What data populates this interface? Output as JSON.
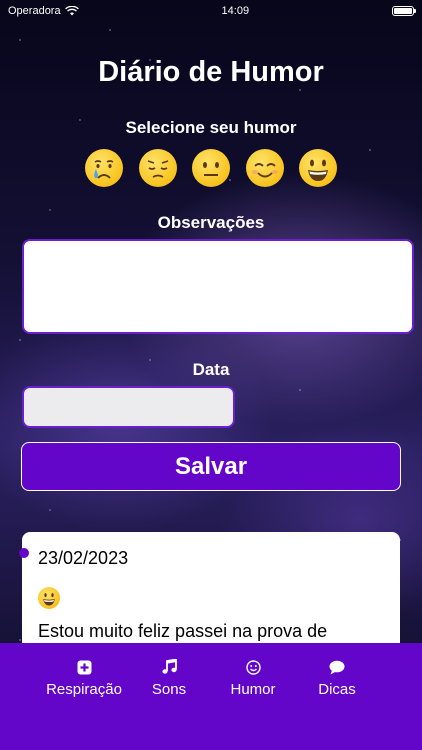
{
  "status_bar": {
    "carrier": "Operadora",
    "time": "14:09"
  },
  "header": {
    "title": "Diário de Humor"
  },
  "mood": {
    "label": "Selecione seu humor",
    "options": [
      {
        "name": "crying",
        "icon": "crying-face-icon"
      },
      {
        "name": "sad",
        "icon": "pensive-face-icon"
      },
      {
        "name": "neutral",
        "icon": "neutral-face-icon"
      },
      {
        "name": "happy",
        "icon": "smiling-face-icon"
      },
      {
        "name": "very-happy",
        "icon": "grinning-face-icon"
      }
    ]
  },
  "observations": {
    "label": "Observações",
    "value": "",
    "placeholder": ""
  },
  "date": {
    "label": "Data",
    "value": "",
    "placeholder": ""
  },
  "save_button": {
    "label": "Salvar"
  },
  "entries": [
    {
      "date": "23/02/2023",
      "mood_icon": "grinning-face-icon",
      "text": "Estou muito feliz passei na prova de"
    }
  ],
  "tab_bar": {
    "tabs": [
      {
        "label": "Respiração",
        "icon": "plus-square-icon"
      },
      {
        "label": "Sons",
        "icon": "music-note-icon"
      },
      {
        "label": "Humor",
        "icon": "smile-icon"
      },
      {
        "label": "Dicas",
        "icon": "chat-bubble-icon"
      }
    ]
  },
  "colors": {
    "accent": "#6306c9",
    "input_border": "#6a1fd1",
    "emoji_yellow": "#f8c21d"
  }
}
